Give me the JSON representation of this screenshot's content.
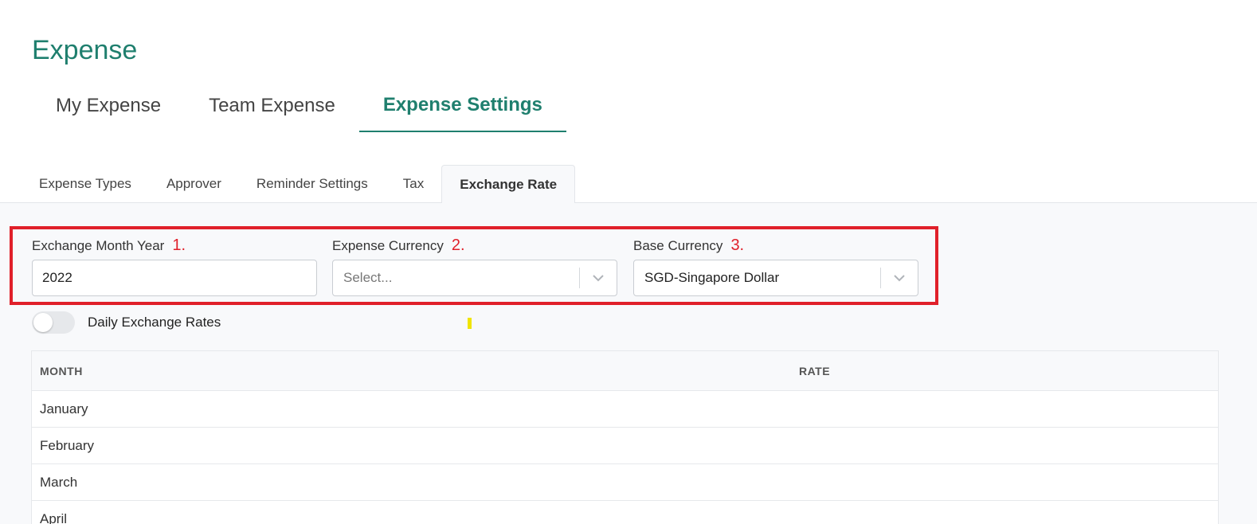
{
  "app": {
    "title": "Expense"
  },
  "main_tabs": [
    {
      "label": "My Expense"
    },
    {
      "label": "Team Expense"
    },
    {
      "label": "Expense Settings",
      "active": true
    }
  ],
  "sub_tabs": [
    {
      "label": "Expense Types"
    },
    {
      "label": "Approver"
    },
    {
      "label": "Reminder Settings"
    },
    {
      "label": "Tax"
    },
    {
      "label": "Exchange Rate",
      "active": true
    }
  ],
  "filters": {
    "month_year": {
      "label": "Exchange Month Year",
      "number": "1.",
      "value": "2022"
    },
    "expense_currency": {
      "label": "Expense Currency",
      "number": "2.",
      "placeholder": "Select..."
    },
    "base_currency": {
      "label": "Base Currency",
      "number": "3.",
      "value": "SGD-Singapore Dollar"
    }
  },
  "daily_toggle": {
    "label": "Daily Exchange Rates",
    "on": false
  },
  "table": {
    "headers": {
      "month": "MONTH",
      "rate": "RATE"
    },
    "rows": [
      {
        "month": "January",
        "rate": ""
      },
      {
        "month": "February",
        "rate": ""
      },
      {
        "month": "March",
        "rate": ""
      },
      {
        "month": "April",
        "rate": ""
      }
    ]
  },
  "colors": {
    "brand": "#1f7f6e",
    "annotation_red": "#e0202a",
    "marker_yellow": "#f0e400"
  },
  "icons": {
    "dropdown": "chevron-down-icon"
  }
}
